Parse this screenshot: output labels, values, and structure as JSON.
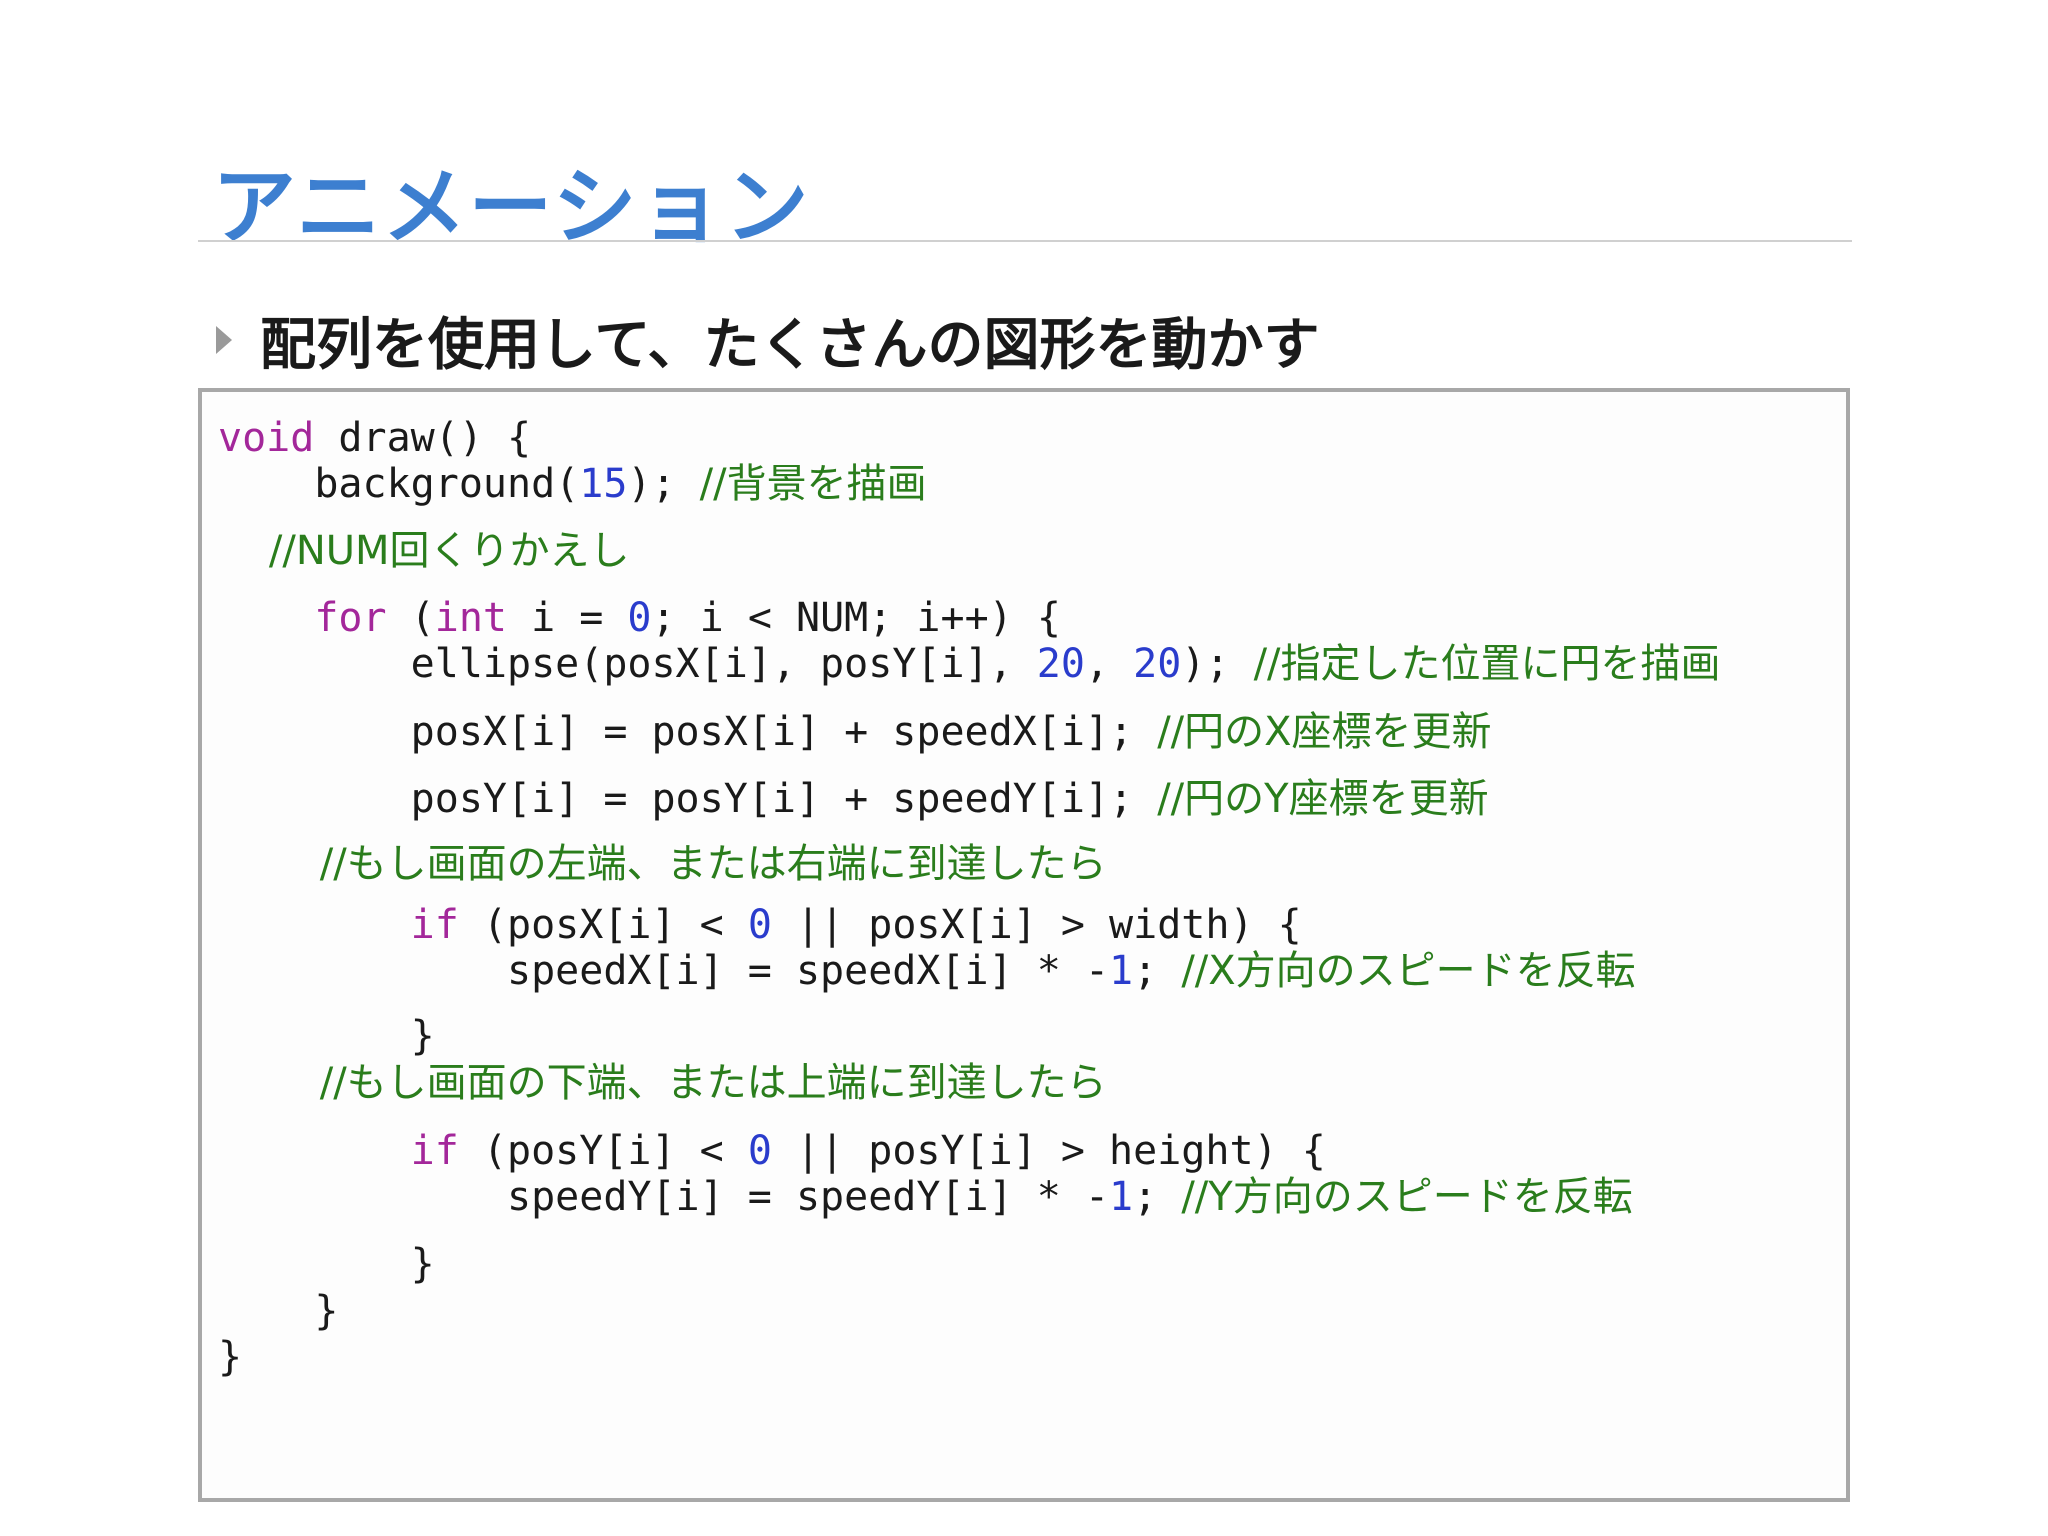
{
  "slide": {
    "title": "アニメーション",
    "bullet": "配列を使用して、たくさんの図形を動かす"
  },
  "code": {
    "line01": {
      "kw": "void",
      "text": " draw() {"
    },
    "line02": {
      "pre": "    background(",
      "num": "15",
      "post": "); ",
      "comment": "//背景を描画"
    },
    "line03": {
      "comment": "    //NUM回くりかえし"
    },
    "line04": {
      "kw1": "for",
      "mid1": " (",
      "kw2": "int",
      "mid2": " i = ",
      "num": "0",
      "post": "; i < NUM; i++) {"
    },
    "line05": {
      "pre": "        ellipse(posX[i], posY[i], ",
      "num1": "20",
      "sep": ", ",
      "num2": "20",
      "post": "); ",
      "comment": "//指定した位置に円を描画"
    },
    "line06": {
      "pre": "        posX[i] = posX[i] + speedX[i]; ",
      "comment": "//円のX座標を更新"
    },
    "line07": {
      "pre": "        posY[i] = posY[i] + speedY[i]; ",
      "comment": "//円のY座標を更新"
    },
    "line08": {
      "comment": "        //もし画面の左端、または右端に到達したら"
    },
    "line09": {
      "pre": "        ",
      "kw": "if",
      "mid": " (posX[i] < ",
      "num": "0",
      "post": " || posX[i] > width) {"
    },
    "line10": {
      "pre": "            speedX[i] = speedX[i] * -",
      "num": "1",
      "post": "; ",
      "comment": "//X方向のスピードを反転"
    },
    "line11": {
      "text": "        }"
    },
    "line12": {
      "comment": "        //もし画面の下端、または上端に到達したら"
    },
    "line13": {
      "pre": "        ",
      "kw": "if",
      "mid": " (posY[i] < ",
      "num": "0",
      "post": " || posY[i] > height) {"
    },
    "line14": {
      "pre": "            speedY[i] = speedY[i] * -",
      "num": "1",
      "post": "; ",
      "comment": "//Y方向のスピードを反転"
    },
    "line15": {
      "text": "        }"
    },
    "line16": {
      "text": "    }"
    },
    "line17": {
      "text": "}"
    }
  },
  "colors": {
    "title": "#3d7fd0",
    "keyword": "#a3279a",
    "number": "#2a3ccc",
    "comment": "#2a7d1c",
    "text": "#1a1a1a",
    "border": "#a8a8a8"
  }
}
